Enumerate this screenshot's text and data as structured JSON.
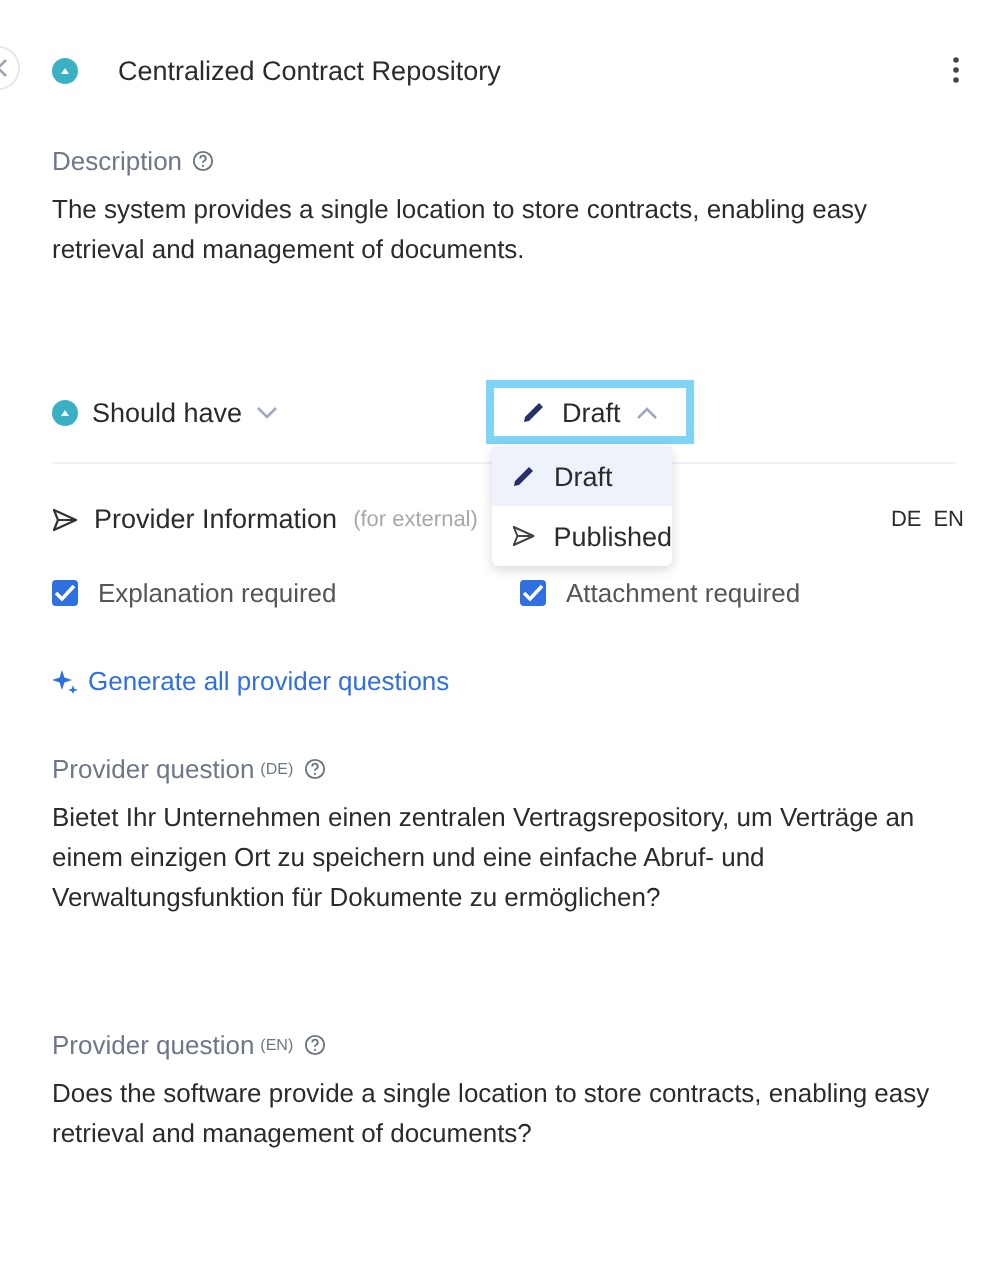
{
  "header": {
    "title": "Centralized Contract Repository"
  },
  "description": {
    "label": "Description",
    "text": "The system provides a single location to store contracts, enabling easy retrieval and management of documents."
  },
  "priority": {
    "label": "Should have"
  },
  "status": {
    "label": "Draft",
    "expanded": true,
    "options": [
      {
        "label": "Draft",
        "kind": "draft",
        "selected": true
      },
      {
        "label": "Published",
        "kind": "published",
        "selected": false
      }
    ]
  },
  "provider_information": {
    "title": "Provider Information",
    "note": "(for external)",
    "languages": [
      "DE",
      "EN"
    ]
  },
  "checkboxes": [
    {
      "label": "Explanation required",
      "checked": true
    },
    {
      "label": "Attachment required",
      "checked": true
    }
  ],
  "generate_link": "Generate all provider questions",
  "questions": [
    {
      "label": "Provider question",
      "lang": "(DE)",
      "text": "Bietet Ihr Unternehmen einen zentralen Vertragsrepository, um Verträge an einem einzigen Ort zu speichern und eine einfache Abruf- und Verwaltungsfunktion für Dokumente zu ermöglichen?"
    },
    {
      "label": "Provider question",
      "lang": "(EN)",
      "text": "Does the software provide a single location to store contracts, enabling easy retrieval and management of documents?"
    }
  ]
}
